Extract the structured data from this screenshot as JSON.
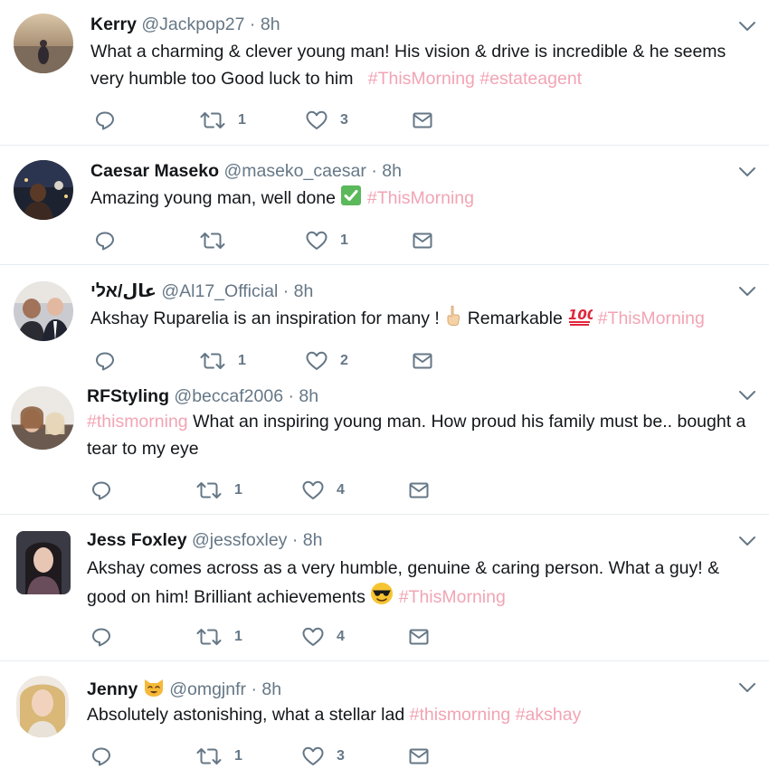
{
  "tweets": [
    {
      "name": "Kerry",
      "handle": "@Jackpop27",
      "sep": "·",
      "time": "8h",
      "text_1": "What a charming & clever young man! His vision & drive is incredible & he seems very humble too Good luck to him",
      "hashtag_1": "#ThisMorning",
      "hashtag_2": "#estateagent",
      "retweets": "1",
      "likes": "3"
    },
    {
      "name": "Caesar Maseko",
      "handle": "@maseko_caesar",
      "sep": "·",
      "time": "8h",
      "text_1": "Amazing young man, well done",
      "hashtag_1": "#ThisMorning",
      "retweets": "",
      "likes": "1"
    },
    {
      "name": "عال/אלי",
      "handle": "@Al17_Official",
      "sep": "·",
      "time": "8h",
      "text_1": "Akshay Ruparelia is an inspiration for many !",
      "text_2": "Remarkable",
      "hashtag_1": "#ThisMorning",
      "retweets": "1",
      "likes": "2"
    },
    {
      "name": "RFStyling",
      "handle": "@beccaf2006",
      "sep": "·",
      "time": "8h",
      "hashtag_1": "#thismorning",
      "text_1": "What an inspiring young man. How proud his family must be.. bought a tear to my eye",
      "retweets": "1",
      "likes": "4"
    },
    {
      "name": "Jess Foxley",
      "handle": "@jessfoxley",
      "sep": "·",
      "time": "8h",
      "text_1": "Akshay comes across as a very humble, genuine & caring person. What a guy! & good on him! Brilliant achievements",
      "hashtag_1": "#ThisMorning",
      "retweets": "1",
      "likes": "4"
    },
    {
      "name": "Jenny",
      "handle": "@omgjnfr",
      "sep": "·",
      "time": "8h",
      "text_1": "Absolutely astonishing, what a stellar lad",
      "hashtag_1": "#thismorning",
      "hashtag_2": "#akshay",
      "retweets": "1",
      "likes": "3"
    }
  ],
  "icons": {
    "reply": "reply-icon",
    "retweet": "retweet-icon",
    "like": "like-icon",
    "dm": "direct-message-icon",
    "caret": "chevron-down-icon"
  },
  "colors": {
    "hashtag": "#f2a4b4",
    "meta": "#657786",
    "icon": "#657786",
    "divider": "#e6ecf0"
  }
}
